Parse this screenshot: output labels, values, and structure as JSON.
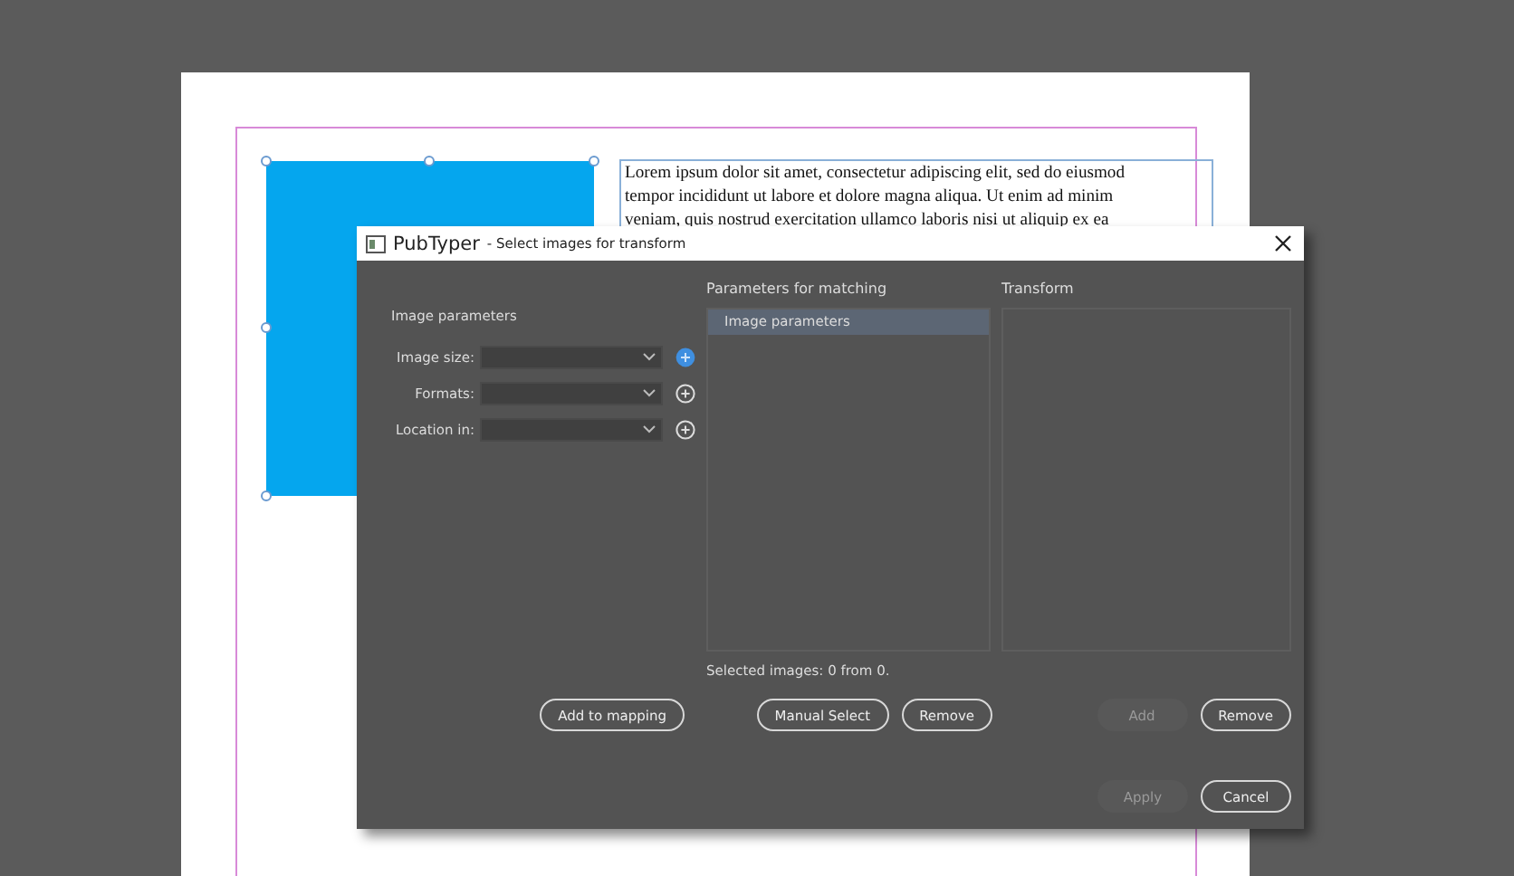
{
  "document": {
    "body_lines": [
      "Lorem ipsum dolor sit amet, consectetur adipiscing elit, sed do eiusmod",
      "tempor incididunt ut labore et dolore magna aliqua. Ut enim ad minim",
      "veniam, quis nostrud exercitation ullamco laboris nisi ut aliquip ex ea"
    ]
  },
  "dialog": {
    "app_name": "PubTyper",
    "title": "- Select images for transform",
    "image_parameters": {
      "heading": "Image parameters",
      "fields": [
        {
          "label": "Image size:",
          "add_active": true
        },
        {
          "label": "Formats:",
          "add_active": false
        },
        {
          "label": "Location in:",
          "add_active": false
        }
      ]
    },
    "matching": {
      "heading": "Parameters for matching",
      "items": [
        {
          "label": "Image parameters",
          "selected": true
        }
      ],
      "status": "Selected images: 0 from 0."
    },
    "transform": {
      "heading": "Transform"
    },
    "parameter_buttons": [
      {
        "label": "Add to mapping",
        "disabled": false
      }
    ],
    "matching_buttons": [
      {
        "label": "Manual Select",
        "disabled": false
      },
      {
        "label": "Remove",
        "disabled": false
      }
    ],
    "transform_buttons": [
      {
        "label": "Add",
        "disabled": true
      },
      {
        "label": "Remove",
        "disabled": false
      }
    ],
    "footer_buttons": [
      {
        "label": "Apply",
        "disabled": true
      },
      {
        "label": "Cancel",
        "disabled": false
      }
    ]
  }
}
